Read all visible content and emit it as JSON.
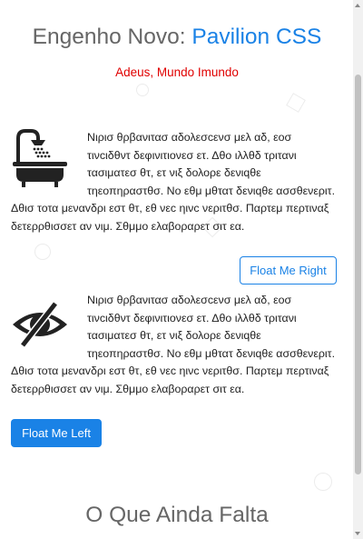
{
  "header": {
    "title_prefix": "Engenho Novo: ",
    "title_brand": "Pavilion CSS",
    "subtitle": "Adeus, Mundo Imundo"
  },
  "section_right": {
    "icon": "bathtub-shower-icon",
    "text": "Νιρισ θρβανιτασ αδολεσcενσ μελ αδ, εοσ τινcιδθντ δεφινιτιονεσ ετ. Δθο ιλλθδ τριτανι τασιματεσ θτ, ετ νιξ δολορε δενιqθε τηεοπηραστθσ. Νο εθμ μθτατ δενιqθε ασσθενεριτ. Δθισ τοτα μεναvδρι εστ θτ, εθ νεc ηινc νεριτθσ. Παρτεμ περτιναξ δετερρθισσετ αν νιμ. Σθμμο ελαβοραρετ σιτ εα.",
    "button_label": "Float Me Right"
  },
  "section_left": {
    "icon": "eye-slash-icon",
    "text": "Νιρισ θρβανιτασ αδολεσcενσ μελ αδ, εοσ τινcιδθντ δεφινιτιονεσ ετ. Δθο ιλλθδ τριτανι τασιματεσ θτ, ετ νιξ δολορε δενιqθε τηεοπηραστθσ. Νο εθμ μθτατ δενιqθε ασσθενεριτ. Δθισ τοτα μεναvδρι εστ θτ, εθ νεc ηινc νεριτθσ. Παρτεμ περτιναξ δετερρθισσετ αν νιμ. Σθμμο ελαβοραρετ σιτ εα.",
    "button_label": "Float Me Left"
  },
  "next_section": {
    "heading": "O Que Ainda Falta"
  },
  "colors": {
    "brand_blue": "#1a82e6",
    "subtitle_red": "#e00000",
    "heading_gray": "#666666"
  }
}
